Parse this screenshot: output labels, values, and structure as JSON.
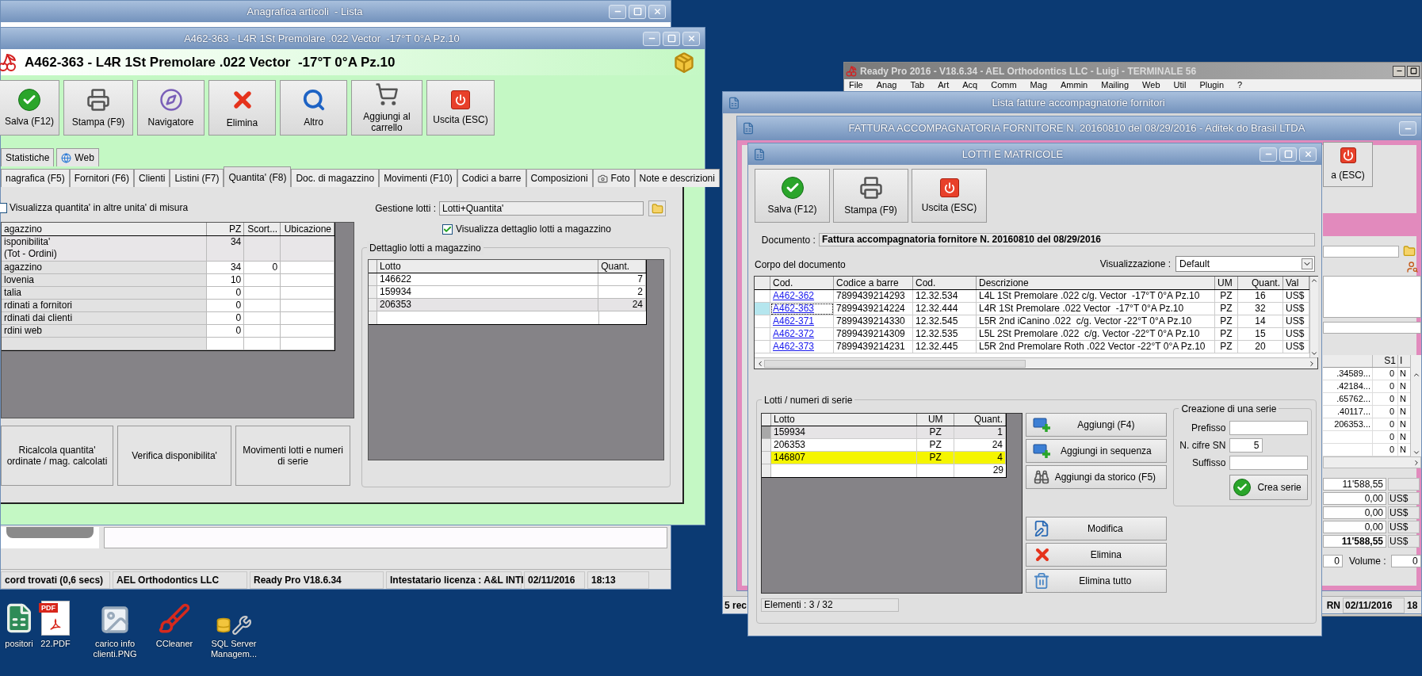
{
  "desktop_icons": [
    {
      "kind": "spreadsheet",
      "label": "positori"
    },
    {
      "kind": "pdf",
      "badge": "PDF",
      "label": "22.PDF"
    },
    {
      "kind": "image",
      "label": "carico info clienti.PNG"
    },
    {
      "kind": "cleaner",
      "label": "CCleaner"
    },
    {
      "kind": "tools",
      "label": "SQL Server Managem..."
    }
  ],
  "list_window": {
    "title": "Anagrafica articoli  - Lista",
    "status_bar": [
      "cord trovati (0,6 secs)",
      "AEL Orthodontics LLC",
      "Ready Pro V18.6.34",
      "Intestatario licenza : A&L INTI",
      "02/11/2016",
      "18:13"
    ]
  },
  "article_window": {
    "title": "A462-363 - L4R 1St Premolare .022 Vector  -17°T 0°A Pz.10",
    "heading": "A462-363 - L4R 1St Premolare .022 Vector  -17°T 0°A Pz.10",
    "toolbar": [
      "Salva (F12)",
      "Stampa (F9)",
      "Navigatore",
      "Elimina",
      "Altro",
      "Aggiungi al carrello",
      "Uscita (ESC)"
    ],
    "upper_tabs": [
      {
        "label": "Statistiche",
        "selected": false
      },
      {
        "label": "Web",
        "selected": false
      }
    ],
    "tabs": [
      {
        "label": "nagrafica (F5)",
        "selected": false
      },
      {
        "label": "Fornitori (F6)",
        "selected": false
      },
      {
        "label": "Clienti",
        "selected": false
      },
      {
        "label": "Listini (F7)",
        "selected": false
      },
      {
        "label": "Quantita' (F8)",
        "selected": true
      },
      {
        "label": "Doc. di magazzino",
        "selected": false
      },
      {
        "label": "Movimenti (F10)",
        "selected": false
      },
      {
        "label": "Codici a barre",
        "selected": false
      },
      {
        "label": "Composizioni",
        "selected": false
      },
      {
        "label": "Foto",
        "selected": false
      },
      {
        "label": "Note e descrizioni",
        "selected": false
      }
    ],
    "other_units": {
      "label": "Visualizza quantita' in altre unita' di misura",
      "checked": false
    },
    "stock_table": {
      "columns": [
        "agazzino",
        "PZ",
        "Scort...",
        "Ubicazione"
      ],
      "rows": [
        {
          "kind": "summary",
          "name": "isponibilita'",
          "note": "(Tot - Ordini)",
          "pz": "34"
        },
        {
          "kind": "location",
          "name": "agazzino",
          "pz": "34",
          "stock": "0"
        },
        {
          "kind": "location",
          "name": "lovenia",
          "pz": "10"
        },
        {
          "kind": "location",
          "name": "talia",
          "pz": "0"
        },
        {
          "kind": "location",
          "name": "rdinati a fornitori",
          "pz": "0"
        },
        {
          "kind": "location",
          "name": "rdinati dai clienti",
          "pz": "0"
        },
        {
          "kind": "location",
          "name": "rdini web",
          "pz": "0"
        }
      ]
    },
    "lot_management": {
      "label": "Gestione lotti :",
      "value": "Lotti+Quantita'"
    },
    "lot_detail_toggle": {
      "label": "Visualizza dettaglio lotti a magazzino",
      "checked": true
    },
    "lot_detail": {
      "title": "Dettaglio lotti a magazzino",
      "columns": [
        "Lotto",
        "Quant."
      ],
      "rows": [
        {
          "lot": "146622",
          "qty": "7",
          "selected": false
        },
        {
          "lot": "159934",
          "qty": "2",
          "selected": false
        },
        {
          "lot": "206353",
          "qty": "24",
          "selected": true
        }
      ]
    },
    "actions": [
      "Ricalcola quantita' ordinate / mag. calcolati",
      "Verifica disponibilita'",
      "Movimenti lotti e numeri di serie"
    ]
  },
  "main_window": {
    "title": "Ready Pro 2016 - V18.6.34 - AEL Orthodontics LLC - Luigi - TERMINALE 56",
    "menu": [
      "File",
      "Anag",
      "Tab",
      "Art",
      "Acq",
      "Comm",
      "Mag",
      "Ammin",
      "Mailing",
      "Web",
      "Util",
      "Plugin",
      "?"
    ]
  },
  "invoice_list_window": {
    "title": "Lista fatture accompagnatorie fornitori",
    "status_bar": [
      "5 rec",
      "RN",
      "02/11/2016",
      "18"
    ]
  },
  "invoice_window": {
    "title": "FATTURA ACCOMPAGNATORIA FORNITORE N. 20160810 del 08/29/2016 - Aditek do Brasil LTDA",
    "exit_button": "a (ESC)",
    "grid": {
      "columns": [
        "S1",
        "I"
      ],
      "rows": [
        {
          "code": ".34589...",
          "s1": "0",
          "flag": "N"
        },
        {
          "code": ".42184...",
          "s1": "0",
          "flag": "N"
        },
        {
          "code": ".65762...",
          "s1": "0",
          "flag": "N"
        },
        {
          "code": ".40117...",
          "s1": "0",
          "flag": "N"
        },
        {
          "code": "206353...",
          "s1": "0",
          "flag": "N"
        },
        {
          "s1": "0",
          "flag": "N"
        },
        {
          "s1": "0",
          "flag": "N"
        }
      ]
    },
    "totals": [
      {
        "kind": "line",
        "value": "11'588,55"
      },
      {
        "kind": "line",
        "value": "0,00",
        "currency": "US$"
      },
      {
        "kind": "line",
        "value": "0,00",
        "currency": "US$"
      },
      {
        "kind": "line",
        "value": "0,00",
        "currency": "US$"
      },
      {
        "kind": "total",
        "value": "11'588,55",
        "currency": "US$"
      }
    ],
    "weight": "0",
    "volume": {
      "label": "Volume :",
      "value": "0"
    }
  },
  "lots_dialog": {
    "title": "LOTTI E MATRICOLE",
    "toolbar": [
      "Salva (F12)",
      "Stampa (F9)",
      "Uscita (ESC)"
    ],
    "document": {
      "label": "Documento :",
      "value": "Fattura accompagnatoria fornitore N. 20160810 del 08/29/2016"
    },
    "body_label": "Corpo del documento",
    "view": {
      "label": "Visualizzazione :",
      "value": "Default"
    },
    "doc_table": {
      "columns": [
        "Cod.",
        "Codice a barre",
        "Cod.",
        "Descrizione",
        "UM",
        "Quant.",
        "Val"
      ],
      "rows": [
        {
          "code": "A462-362",
          "barcode": "7899439214293",
          "ref": "12.32.534",
          "description": "L4L 1St Premolare .022 c/g. Vector  -17°T 0°A Pz.10",
          "um": "PZ",
          "qty": "16",
          "val": "US$",
          "selected": false
        },
        {
          "code": "A462-363",
          "barcode": "7899439214224",
          "ref": "12.32.444",
          "description": "L4R 1St Premolare .022 Vector  -17°T 0°A Pz.10",
          "um": "PZ",
          "qty": "32",
          "val": "US$",
          "selected": true
        },
        {
          "code": "A462-371",
          "barcode": "7899439214330",
          "ref": "12.32.545",
          "description": "L5R 2nd iCanino .022  c/g. Vector -22°T 0°A Pz.10",
          "um": "PZ",
          "qty": "14",
          "val": "US$",
          "selected": false
        },
        {
          "code": "A462-372",
          "barcode": "7899439214309",
          "ref": "12.32.535",
          "description": "L5L 2St Premolare .022  c/g. Vector -22°T 0°A Pz.10",
          "um": "PZ",
          "qty": "15",
          "val": "US$",
          "selected": false
        },
        {
          "code": "A462-373",
          "barcode": "7899439214231",
          "ref": "12.32.445",
          "description": "L5R 2nd Premolare Roth .022 Vector -22°T 0°A Pz.10",
          "um": "PZ",
          "qty": "20",
          "val": "US$",
          "selected": false
        }
      ]
    },
    "lots": {
      "title": "Lotti / numeri di serie",
      "columns": [
        "Lotto",
        "UM",
        "Quant."
      ],
      "rows": [
        {
          "lot": "159934",
          "um": "PZ",
          "qty": "1",
          "selected": true,
          "highlighted": false
        },
        {
          "lot": "206353",
          "um": "PZ",
          "qty": "24",
          "selected": false,
          "highlighted": false
        },
        {
          "lot": "146807",
          "um": "PZ",
          "qty": "4",
          "selected": false,
          "highlighted": true
        }
      ],
      "total": "29",
      "count": "Elementi : 3 / 32"
    },
    "add_buttons": [
      "Aggiungi (F4)",
      "Aggiungi in sequenza",
      "Aggiungi da storico (F5)"
    ],
    "edit_buttons": [
      "Modifica",
      "Elimina",
      "Elimina tutto"
    ],
    "series": {
      "title": "Creazione di una serie",
      "fields": [
        {
          "kind": "wide",
          "label": "Prefisso"
        },
        {
          "kind": "short",
          "label": "N. cifre SN",
          "value": "5"
        },
        {
          "kind": "wide",
          "label": "Suffisso"
        }
      ],
      "create_button": "Crea serie"
    }
  }
}
